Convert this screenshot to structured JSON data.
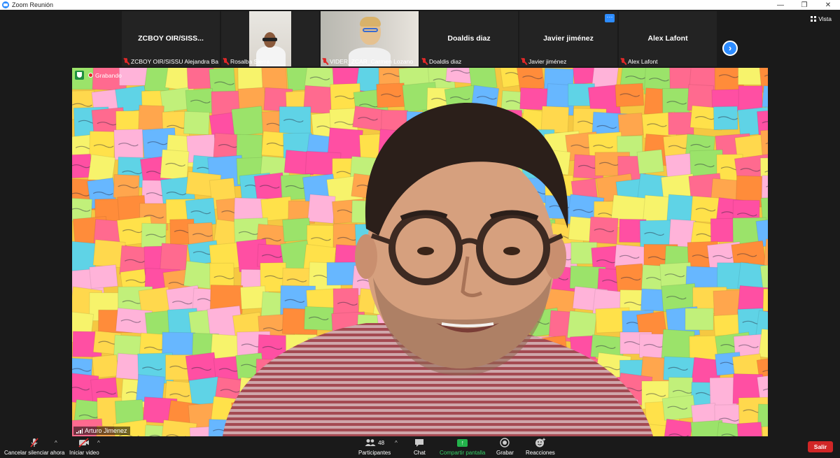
{
  "window": {
    "title": "Zoom Reunión",
    "controls": {
      "minimize": "—",
      "restore": "❐",
      "close": "✕"
    }
  },
  "view_button": {
    "label": "Vista",
    "icon": "grid-icon"
  },
  "participants": [
    {
      "center_name": "ZCBOY  OIR/SISS...",
      "caption": "ZCBOY OIR/SISSU Alejandra Barr...",
      "muted": true,
      "video": false
    },
    {
      "center_name": "",
      "caption": "Rosalba Sierra",
      "muted": true,
      "video": true
    },
    {
      "center_name": "",
      "caption": "VIDER_ZCAR_Carmen Lozano",
      "muted": true,
      "video": true
    },
    {
      "center_name": "Doaldis diaz",
      "caption": "Doaldis diaz",
      "muted": true,
      "video": false
    },
    {
      "center_name": "Javier jiménez",
      "caption": "Javier jiménez",
      "muted": true,
      "video": false
    },
    {
      "center_name": "Alex Lafont",
      "caption": "Alex Lafont",
      "muted": true,
      "video": false
    }
  ],
  "tile_more_label": "···",
  "next_page_label": "›",
  "main": {
    "speaker_name": "Arturo Jimenez",
    "recording_label": "Grabando"
  },
  "toolbar": {
    "unmute_label": "Cancelar silenciar ahora",
    "video_label": "Iniciar video",
    "participants_label": "Participantes",
    "participants_count": "48",
    "chat_label": "Chat",
    "share_label": "Compartir pantalla",
    "record_label": "Grabar",
    "reactions_label": "Reacciones",
    "leave_label": "Salir",
    "caret": "^"
  },
  "colors": {
    "accent": "#2d8cff",
    "muted_red": "#e02828",
    "share_green": "#23b24b",
    "leave_red": "#d12626",
    "background": "#1a1a1a"
  }
}
